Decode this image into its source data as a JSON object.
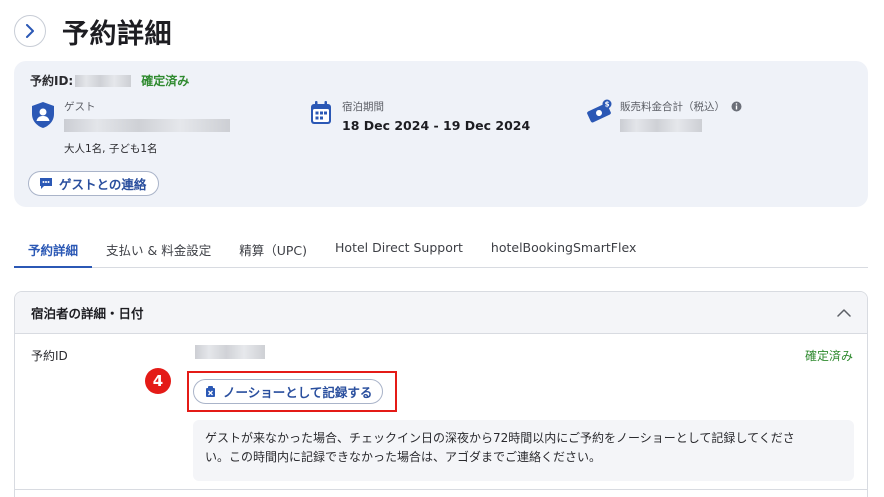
{
  "header": {
    "title": "予約詳細"
  },
  "summary": {
    "booking_id_label": "予約ID:",
    "status": "確定済み",
    "guest": {
      "label": "ゲスト",
      "party": "大人1名, 子ども1名"
    },
    "stay": {
      "label": "宿泊期間",
      "dates": "18 Dec 2024 - 19 Dec 2024"
    },
    "price": {
      "label": "販売料金合計（税込）"
    },
    "contact_button": "ゲストとの連絡"
  },
  "tabs": [
    {
      "label": "予約詳細",
      "active": true
    },
    {
      "label": "支払い & 料金設定"
    },
    {
      "label": "精算（UPC)"
    },
    {
      "label": "Hotel Direct Support"
    },
    {
      "label": "hotelBookingSmartFlex"
    }
  ],
  "section": {
    "title": "宿泊者の詳細・日付",
    "booking_id_label": "予約ID",
    "status": "確定済み",
    "step_number": "4",
    "noshow_button": "ノーショーとして記録する",
    "notice_line1": "ゲストが来なかった場合、チェックイン日の深夜から72時間以内にご予約をノーショーとして記録してくださ",
    "notice_line2": "い。この時間内に記録できなかった場合は、アゴダまでご連絡ください。"
  },
  "colors": {
    "accent": "#2b58b5",
    "success": "#2f8a2f",
    "highlight": "#e41b17"
  },
  "icons": [
    "chevron-right-icon",
    "guest-shield-icon",
    "calendar-icon",
    "money-icon",
    "info-icon",
    "chat-icon",
    "chevron-up-icon",
    "no-show-icon"
  ]
}
